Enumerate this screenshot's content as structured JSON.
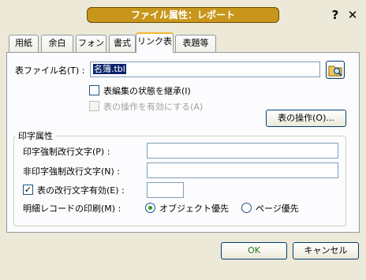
{
  "window": {
    "title": "ファイル属性：レポート",
    "help_icon": "?",
    "close_icon": "✕"
  },
  "tabs": [
    {
      "label": "用紙"
    },
    {
      "label": "余白"
    },
    {
      "label": "フォント"
    },
    {
      "label": "書式"
    },
    {
      "label": "リンク表",
      "active": true
    },
    {
      "label": "表題等"
    }
  ],
  "link_table": {
    "file_label": "表ファイル名(T) :",
    "file_value": "名簿.tbl",
    "browse_icon": "folder-search-icon",
    "inherit_label": "表編集の状態を継承(I)",
    "inherit_checked": false,
    "enable_ops_label": "表の操作を有効にする(A)",
    "enable_ops_checked": false,
    "table_ops_button": "表の操作(O)..."
  },
  "print_attr": {
    "group_title": "印字属性",
    "strong_newline_label": "印字強制改行文字(P) :",
    "strong_newline_value": "",
    "non_print_newline_label": "非印字強制改行文字(N) :",
    "non_print_newline_value": "",
    "table_newline_label": "表の改行文字有効(E) :",
    "table_newline_checked": true,
    "table_newline_value": "",
    "detail_print_label": "明細レコードの印刷(M) :",
    "object_priority_label": "オブジェクト優先",
    "page_priority_label": "ページ優先",
    "selected": "object"
  },
  "footer": {
    "ok_label": "OK",
    "cancel_label": "キャンセル"
  },
  "colors": {
    "title_bar": "#c8961a",
    "accent_tab": "#f1b533",
    "radio_dot": "#21a121"
  }
}
